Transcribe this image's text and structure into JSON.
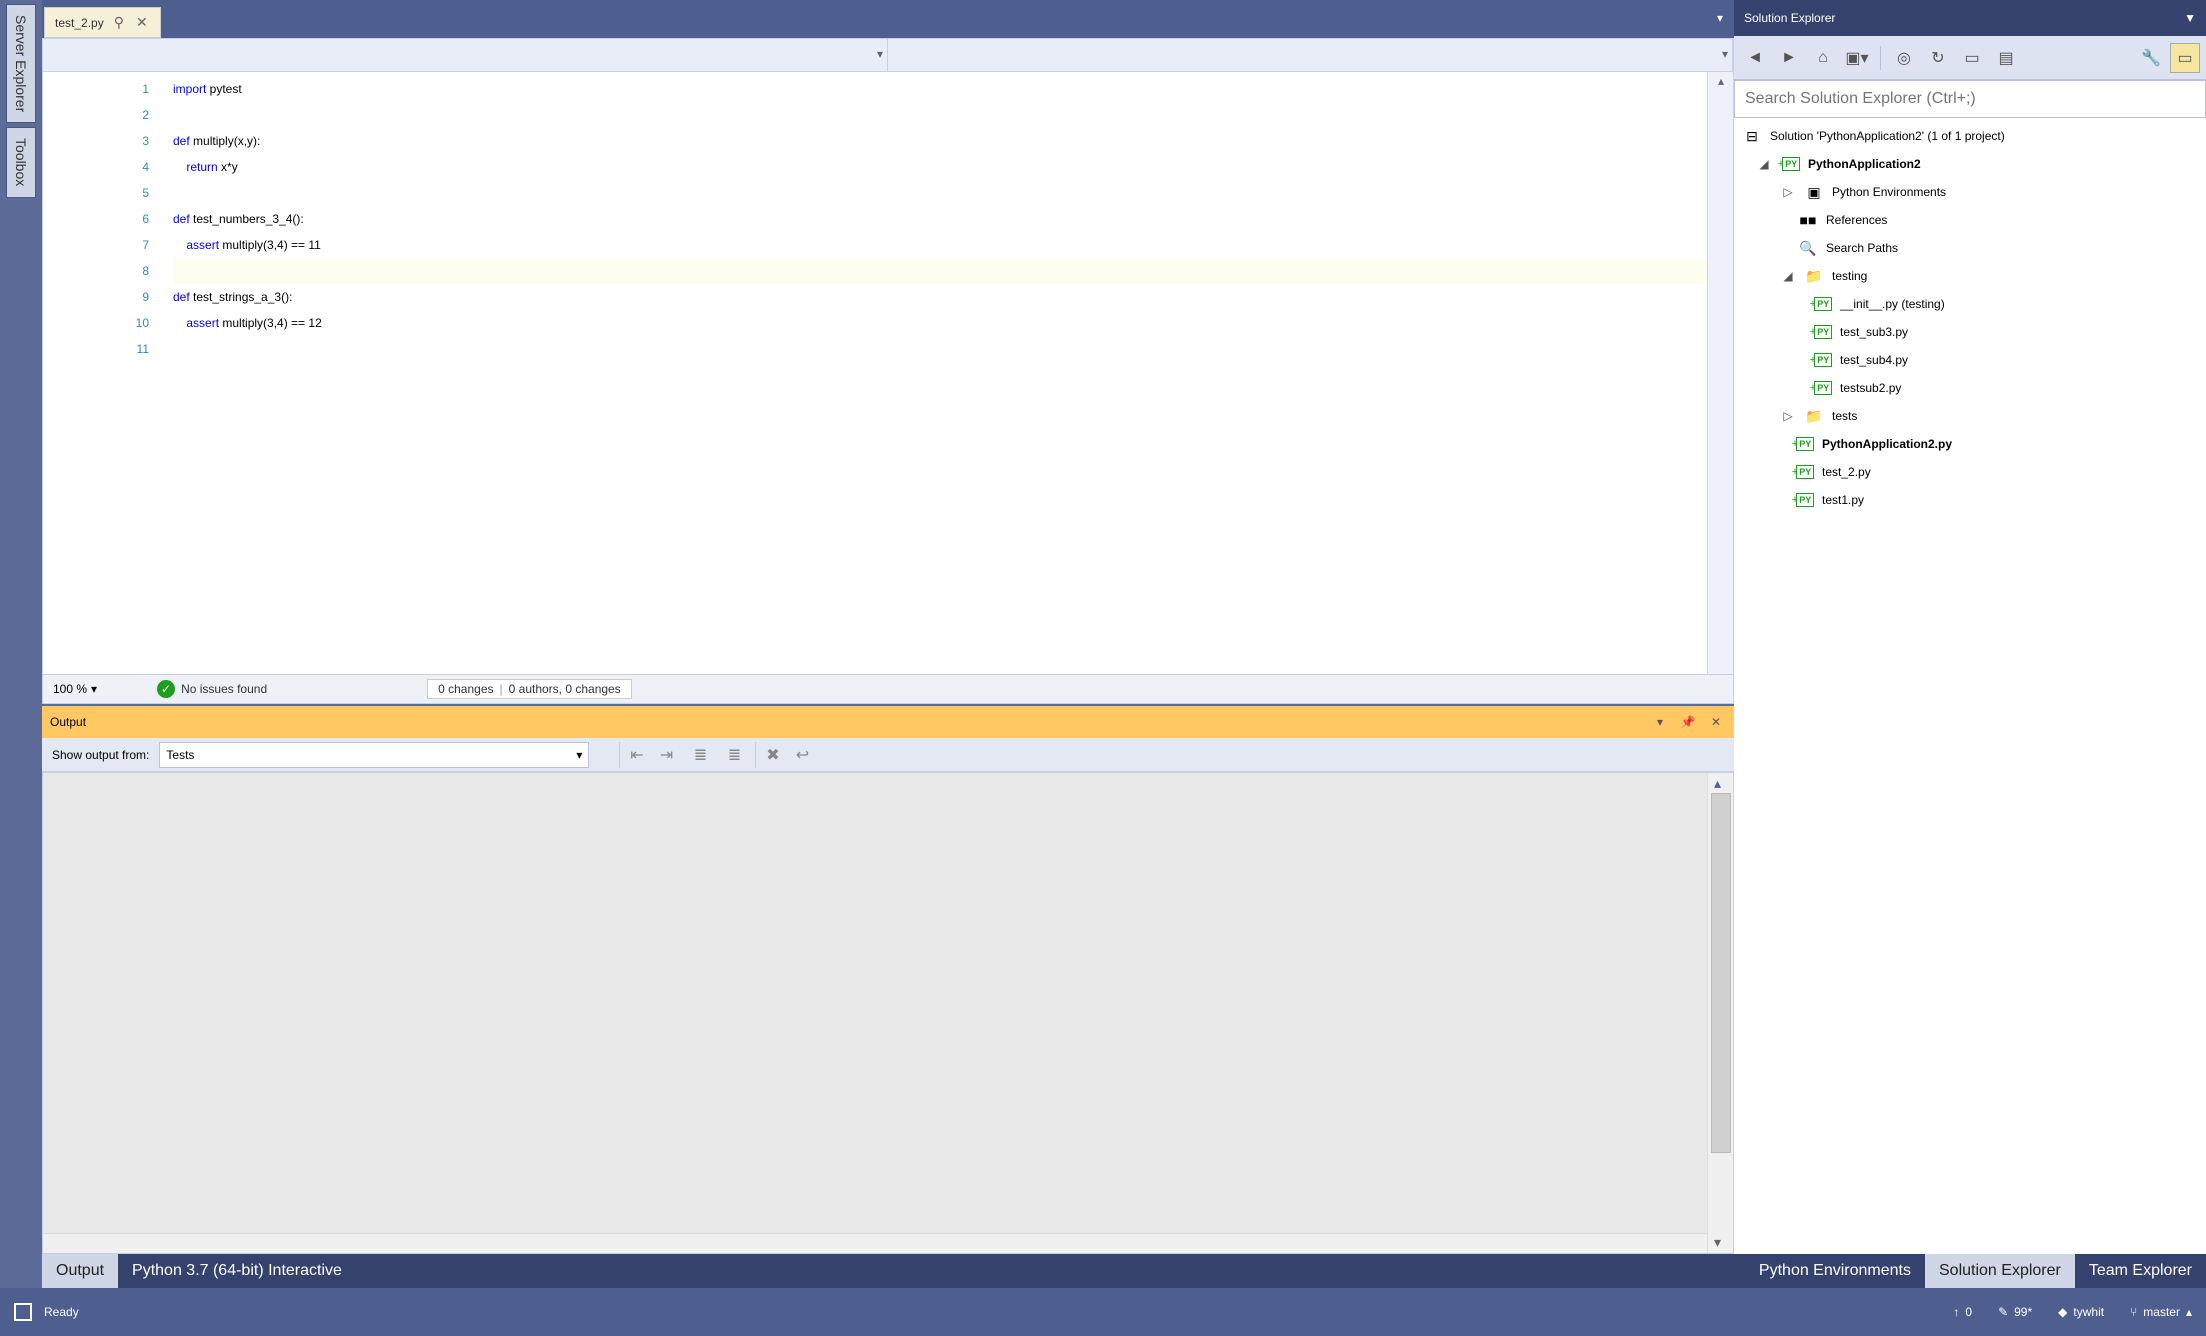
{
  "left_rail": {
    "tabs": [
      "Server Explorer",
      "Toolbox"
    ]
  },
  "file_tab": {
    "name": "test_2.py",
    "pin": "⚲",
    "close": "✕"
  },
  "editor": {
    "lines": [
      {
        "n": 1,
        "parts": [
          [
            "kw",
            "import"
          ],
          [
            "id",
            " pytest"
          ]
        ]
      },
      {
        "n": 2,
        "parts": []
      },
      {
        "n": 3,
        "parts": [
          [
            "kw",
            "def"
          ],
          [
            "id",
            " multiply(x,y):"
          ]
        ]
      },
      {
        "n": 4,
        "parts": [
          [
            "id",
            "    "
          ],
          [
            "kw",
            "return"
          ],
          [
            "id",
            " x*y"
          ]
        ]
      },
      {
        "n": 5,
        "parts": []
      },
      {
        "n": 6,
        "parts": [
          [
            "kw",
            "def"
          ],
          [
            "id",
            " test_numbers_3_4():"
          ]
        ]
      },
      {
        "n": 7,
        "parts": [
          [
            "id",
            "    "
          ],
          [
            "kw",
            "assert"
          ],
          [
            "id",
            " multiply(3,4) == 11"
          ]
        ]
      },
      {
        "n": 8,
        "parts": [],
        "hl": true
      },
      {
        "n": 9,
        "parts": [
          [
            "kw",
            "def"
          ],
          [
            "id",
            " test_strings_a_3():"
          ]
        ]
      },
      {
        "n": 10,
        "parts": [
          [
            "id",
            "    "
          ],
          [
            "kw",
            "assert"
          ],
          [
            "id",
            " multiply(3,4) == 12"
          ]
        ]
      },
      {
        "n": 11,
        "parts": []
      }
    ],
    "zoom": "100 %",
    "issues": "No issues found",
    "changes": {
      "left": "0 changes",
      "right": "0 authors, 0 changes"
    }
  },
  "output": {
    "title": "Output",
    "from_label": "Show output from:",
    "from_value": "Tests"
  },
  "bottom_left_tabs": {
    "active": "Output",
    "other": "Python 3.7 (64-bit) Interactive"
  },
  "solution_explorer": {
    "title": "Solution Explorer",
    "search_placeholder": "Search Solution Explorer (Ctrl+;)",
    "tree": {
      "solution": "Solution 'PythonApplication2' (1 of 1 project)",
      "project": "PythonApplication2",
      "env": "Python Environments",
      "refs": "References",
      "spaths": "Search Paths",
      "testing": "testing",
      "init": "__init__.py (testing)",
      "sub3": "test_sub3.py",
      "sub4": "test_sub4.py",
      "subsub2": "testsub2.py",
      "tests": "tests",
      "app": "PythonApplication2.py",
      "t2": "test_2.py",
      "t1": "test1.py"
    }
  },
  "bottom_right_tabs": {
    "a": "Python Environments",
    "b": "Solution Explorer",
    "c": "Team Explorer"
  },
  "statusbar": {
    "ready": "Ready",
    "up": "0",
    "pencil": "99*",
    "user": "tywhit",
    "branch": "master"
  }
}
